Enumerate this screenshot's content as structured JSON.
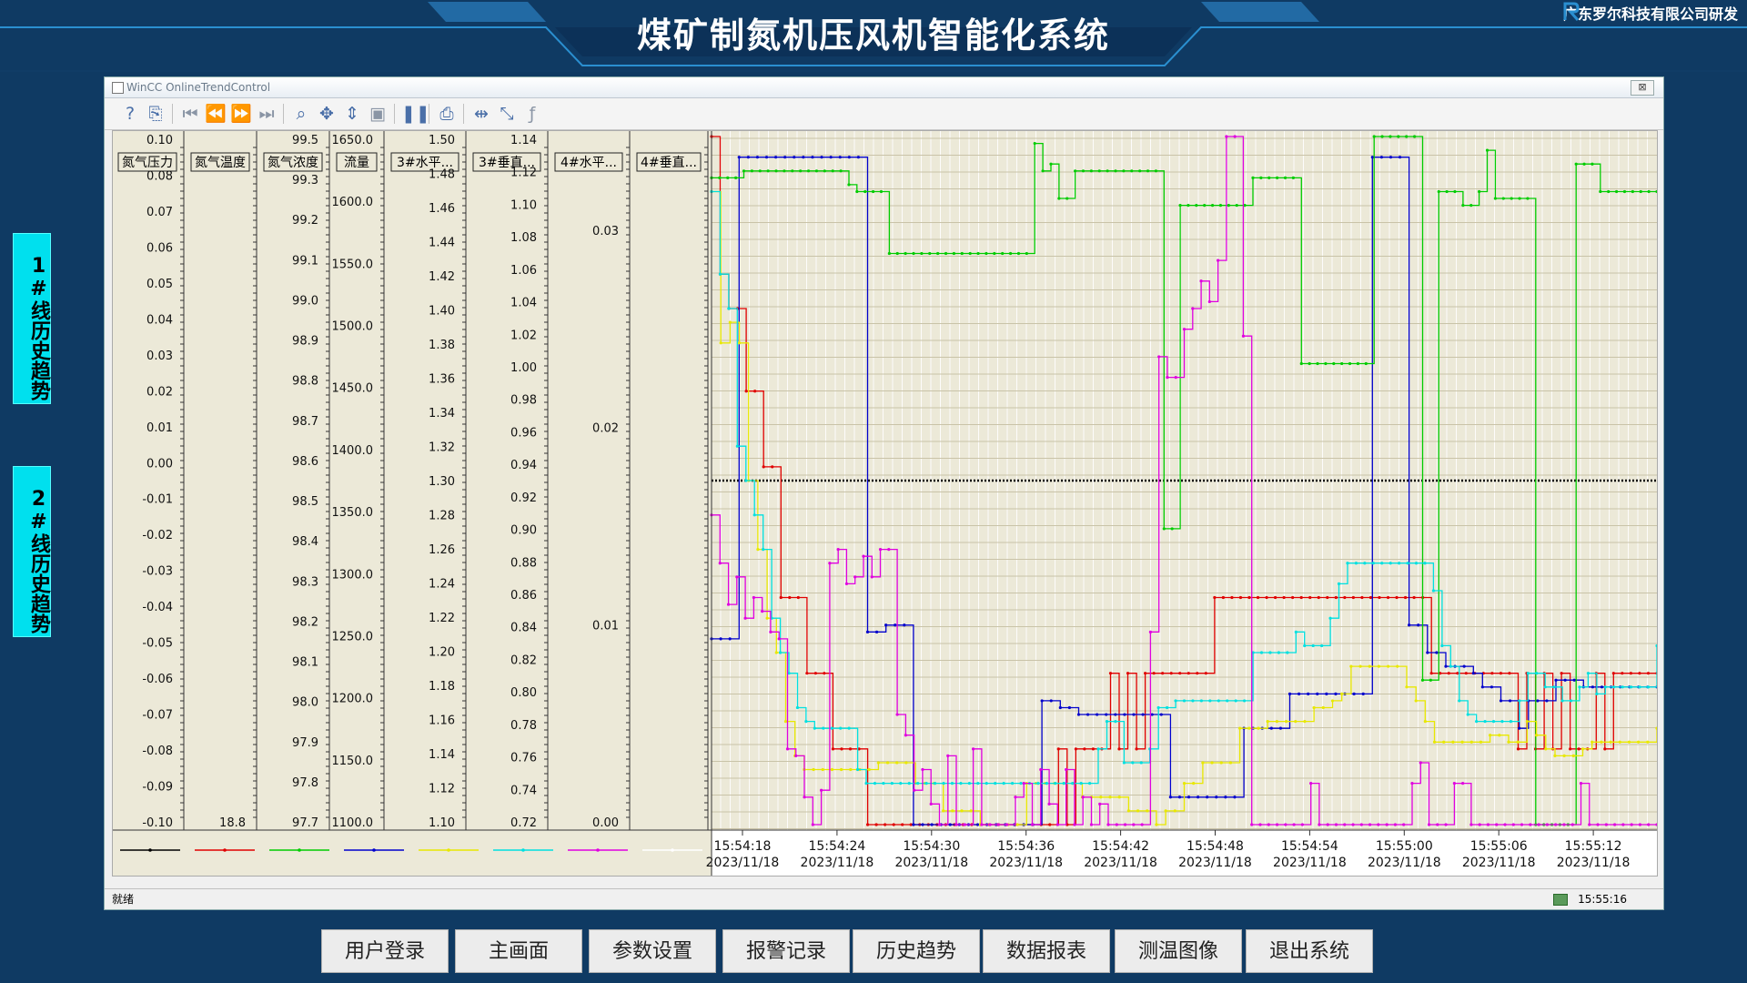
{
  "header": {
    "title": "煤矿制氮机压风机智能化系统",
    "company": "广东罗尔科技有限公司研发"
  },
  "side": {
    "line1": "1#线历史趋势",
    "line2": "2#线历史趋势"
  },
  "window": {
    "title": "WinCC OnlineTrendControl",
    "close": "⊠",
    "status_left": "就绪",
    "status_time": "15:55:16"
  },
  "colors": {
    "bg": "#0f3a63",
    "plot_bg": "#ece9d8",
    "cyan": "#00e0ee"
  },
  "axes": [
    {
      "label": "氮气压力",
      "ticks": [
        "0.10",
        "0.08",
        "0.07",
        "0.06",
        "0.05",
        "0.04",
        "0.03",
        "0.02",
        "0.01",
        "0.00",
        "-0.01",
        "-0.02",
        "-0.03",
        "-0.04",
        "-0.05",
        "-0.06",
        "-0.07",
        "-0.08",
        "-0.09",
        "-0.10"
      ]
    },
    {
      "label": "氮气温度",
      "ticks": [
        "18.8"
      ]
    },
    {
      "label": "氮气浓度",
      "ticks": [
        "99.5",
        "99.3",
        "99.2",
        "99.1",
        "99.0",
        "98.9",
        "98.8",
        "98.7",
        "98.6",
        "98.5",
        "98.4",
        "98.3",
        "98.2",
        "98.1",
        "98.0",
        "97.9",
        "97.8",
        "97.7"
      ]
    },
    {
      "label": "流量",
      "ticks": [
        "1650.0",
        "1600.0",
        "1550.0",
        "1500.0",
        "1450.0",
        "1400.0",
        "1350.0",
        "1300.0",
        "1250.0",
        "1200.0",
        "1150.0",
        "1100.0"
      ]
    },
    {
      "label": "3#水平...",
      "ticks": [
        "1.50",
        "1.48",
        "1.46",
        "1.44",
        "1.42",
        "1.40",
        "1.38",
        "1.36",
        "1.34",
        "1.32",
        "1.30",
        "1.28",
        "1.26",
        "1.24",
        "1.22",
        "1.20",
        "1.18",
        "1.16",
        "1.14",
        "1.12",
        "1.10"
      ]
    },
    {
      "label": "3#垂直...",
      "ticks": [
        "1.14",
        "1.12",
        "1.10",
        "1.08",
        "1.06",
        "1.04",
        "1.02",
        "1.00",
        "0.98",
        "0.96",
        "0.94",
        "0.92",
        "0.90",
        "0.88",
        "0.86",
        "0.84",
        "0.82",
        "0.80",
        "0.78",
        "0.76",
        "0.74",
        "0.72"
      ]
    },
    {
      "label": "4#水平...",
      "ticks": [
        "0.03",
        "0.02",
        "0.01",
        "0.00"
      ]
    },
    {
      "label": "4#垂直...",
      "ticks": []
    }
  ],
  "legend_colors": [
    "#000000",
    "#e00000",
    "#00cc00",
    "#0000cc",
    "#e8e800",
    "#00e0e0",
    "#e000e0",
    "#ffffff"
  ],
  "series": [
    {
      "color": "#e00000",
      "values": [
        1.0,
        0.8,
        0.75,
        0.75,
        0.63,
        0.63,
        0.52,
        0.52,
        0.33,
        0.33,
        0.33,
        0.22,
        0.22,
        0.22,
        0.11,
        0.11,
        0.11,
        0.11,
        0.0,
        0.0,
        0.0,
        0.0,
        0.0,
        0.0,
        0.0,
        0.0,
        0.0,
        0.0,
        0.0,
        0.0,
        0.0,
        0.0,
        0.0,
        0.0,
        0.0,
        0.0,
        0.0,
        0.0,
        0.0,
        0.0,
        0.11,
        0.0,
        0.11,
        0.11,
        0.11,
        0.11,
        0.22,
        0.11,
        0.22,
        0.11,
        0.22,
        0.22,
        0.22,
        0.22,
        0.22,
        0.22,
        0.22,
        0.22,
        0.33,
        0.33,
        0.33,
        0.33,
        0.33,
        0.33,
        0.33,
        0.33,
        0.33,
        0.33,
        0.33,
        0.33,
        0.33,
        0.33,
        0.33,
        0.33,
        0.33,
        0.33,
        0.33,
        0.33,
        0.33,
        0.33,
        0.33,
        0.33,
        0.33,
        0.22,
        0.22,
        0.22,
        0.22,
        0.22,
        0.22,
        0.22,
        0.22,
        0.22,
        0.22,
        0.11,
        0.22,
        0.11,
        0.22,
        0.11,
        0.22,
        0.11,
        0.11,
        0.11,
        0.22,
        0.11,
        0.22,
        0.22,
        0.22,
        0.22,
        0.22,
        0.22
      ]
    },
    {
      "color": "#0000cc",
      "values": [
        0.27,
        0.27,
        0.27,
        0.97,
        0.97,
        0.97,
        0.97,
        0.97,
        0.97,
        0.97,
        0.97,
        0.97,
        0.97,
        0.97,
        0.97,
        0.97,
        0.97,
        0.28,
        0.28,
        0.29,
        0.29,
        0.29,
        0.0,
        0.0,
        0.0,
        0.0,
        0.0,
        0.0,
        0.0,
        0.0,
        0.0,
        0.0,
        0.0,
        0.0,
        0.0,
        0.0,
        0.18,
        0.18,
        0.17,
        0.17,
        0.16,
        0.16,
        0.16,
        0.16,
        0.16,
        0.16,
        0.16,
        0.16,
        0.16,
        0.16,
        0.04,
        0.04,
        0.04,
        0.04,
        0.04,
        0.04,
        0.04,
        0.04,
        0.14,
        0.14,
        0.14,
        0.14,
        0.14,
        0.19,
        0.19,
        0.19,
        0.19,
        0.19,
        0.19,
        0.19,
        0.19,
        0.19,
        0.97,
        0.97,
        0.97,
        0.97,
        0.29,
        0.29,
        0.25,
        0.25,
        0.23,
        0.23,
        0.23,
        0.22,
        0.2,
        0.2,
        0.18,
        0.18,
        0.14,
        0.18,
        0.18,
        0.18,
        0.21,
        0.21,
        0.21,
        0.2,
        0.2,
        0.2,
        0.2,
        0.2,
        0.2,
        0.2,
        0.2,
        0.2
      ]
    },
    {
      "color": "#00cc00",
      "values": [
        0.94,
        0.94,
        0.94,
        0.94,
        0.95,
        0.95,
        0.95,
        0.95,
        0.95,
        0.95,
        0.95,
        0.95,
        0.95,
        0.95,
        0.95,
        0.95,
        0.95,
        0.93,
        0.92,
        0.92,
        0.92,
        0.92,
        0.83,
        0.83,
        0.83,
        0.83,
        0.83,
        0.83,
        0.83,
        0.83,
        0.83,
        0.83,
        0.83,
        0.83,
        0.83,
        0.83,
        0.83,
        0.83,
        0.83,
        0.83,
        0.99,
        0.95,
        0.96,
        0.91,
        0.91,
        0.95,
        0.95,
        0.95,
        0.95,
        0.95,
        0.95,
        0.95,
        0.95,
        0.95,
        0.95,
        0.95,
        0.43,
        0.43,
        0.9,
        0.9,
        0.9,
        0.9,
        0.9,
        0.9,
        0.9,
        0.9,
        0.9,
        0.94,
        0.94,
        0.94,
        0.94,
        0.94,
        0.94,
        0.67,
        0.67,
        0.67,
        0.67,
        0.67,
        0.67,
        0.67,
        0.67,
        0.67,
        1.0,
        1.0,
        1.0,
        1.0,
        1.0,
        1.0,
        0.21,
        0.21,
        0.92,
        0.92,
        0.92,
        0.9,
        0.9,
        0.92,
        0.98,
        0.91,
        0.91,
        0.91,
        0.91,
        0.91,
        0.0,
        0.0,
        0.0,
        0.0,
        0.0,
        0.96,
        0.96,
        0.96,
        0.92,
        0.92,
        0.92,
        0.92,
        0.92,
        0.92,
        0.92,
        0.92
      ]
    },
    {
      "color": "#e8e800",
      "values": [
        0.92,
        0.7,
        0.73,
        0.7,
        0.5,
        0.4,
        0.3,
        0.25,
        0.15,
        0.1,
        0.08,
        0.08,
        0.08,
        0.08,
        0.08,
        0.08,
        0.08,
        0.08,
        0.09,
        0.09,
        0.09,
        0.09,
        0.06,
        0.06,
        0.06,
        0.02,
        0.02,
        0.02,
        0.02,
        0.0,
        0.0,
        0.0,
        0.0,
        0.0,
        0.06,
        0.06,
        0.06,
        0.06,
        0.06,
        0.06,
        0.04,
        0.04,
        0.04,
        0.04,
        0.04,
        0.02,
        0.02,
        0.02,
        0.0,
        0.02,
        0.02,
        0.06,
        0.06,
        0.09,
        0.09,
        0.09,
        0.09,
        0.14,
        0.14,
        0.14,
        0.15,
        0.15,
        0.15,
        0.15,
        0.15,
        0.17,
        0.17,
        0.18,
        0.19,
        0.23,
        0.23,
        0.23,
        0.23,
        0.23,
        0.23,
        0.2,
        0.18,
        0.15,
        0.12,
        0.12,
        0.12,
        0.12,
        0.12,
        0.12,
        0.13,
        0.13,
        0.12,
        0.12,
        0.15,
        0.13,
        0.11,
        0.1,
        0.1,
        0.1,
        0.11,
        0.12,
        0.12,
        0.12,
        0.12,
        0.12,
        0.12,
        0.12,
        0.14
      ]
    },
    {
      "color": "#00e0e0",
      "values": [
        0.92,
        0.8,
        0.75,
        0.55,
        0.5,
        0.45,
        0.4,
        0.3,
        0.25,
        0.22,
        0.17,
        0.15,
        0.14,
        0.14,
        0.14,
        0.14,
        0.14,
        0.08,
        0.06,
        0.06,
        0.06,
        0.06,
        0.06,
        0.06,
        0.06,
        0.06,
        0.06,
        0.06,
        0.06,
        0.06,
        0.06,
        0.06,
        0.06,
        0.06,
        0.06,
        0.06,
        0.06,
        0.06,
        0.06,
        0.06,
        0.06,
        0.06,
        0.06,
        0.06,
        0.06,
        0.11,
        0.15,
        0.15,
        0.09,
        0.09,
        0.09,
        0.11,
        0.17,
        0.17,
        0.18,
        0.18,
        0.18,
        0.18,
        0.18,
        0.18,
        0.18,
        0.18,
        0.18,
        0.25,
        0.25,
        0.25,
        0.25,
        0.25,
        0.28,
        0.26,
        0.26,
        0.26,
        0.3,
        0.35,
        0.38,
        0.38,
        0.38,
        0.38,
        0.38,
        0.38,
        0.38,
        0.38,
        0.38,
        0.38,
        0.34,
        0.26,
        0.23,
        0.18,
        0.16,
        0.15,
        0.15,
        0.15,
        0.15,
        0.15,
        0.18,
        0.22,
        0.22,
        0.2,
        0.2,
        0.18,
        0.18,
        0.2,
        0.22,
        0.19,
        0.2,
        0.2,
        0.2,
        0.2,
        0.2,
        0.2,
        0.26
      ]
    },
    {
      "color": "#e000e0",
      "values": [
        0.45,
        0.38,
        0.32,
        0.36,
        0.3,
        0.33,
        0.31,
        0.28,
        0.27,
        0.11,
        0.1,
        0.04,
        0.0,
        0.05,
        0.38,
        0.4,
        0.35,
        0.36,
        0.39,
        0.36,
        0.4,
        0.4,
        0.16,
        0.13,
        0.05,
        0.08,
        0.03,
        0.0,
        0.1,
        0.0,
        0.0,
        0.11,
        0.0,
        0.0,
        0.0,
        0.0,
        0.04,
        0.06,
        0.0,
        0.08,
        0.03,
        0.0,
        0.08,
        0.0,
        0.04,
        0.0,
        0.03,
        0.0,
        0.0,
        0.0,
        0.0,
        0.0,
        0.28,
        0.68,
        0.65,
        0.65,
        0.72,
        0.75,
        0.79,
        0.76,
        0.82,
        1.0,
        1.0,
        0.71,
        0.0,
        0.0,
        0.0,
        0.0,
        0.0,
        0.0,
        0.0,
        0.06,
        0.0,
        0.0,
        0.0,
        0.0,
        0.0,
        0.0,
        0.0,
        0.0,
        0.0,
        0.0,
        0.0,
        0.06,
        0.09,
        0.0,
        0.0,
        0.0,
        0.06,
        0.06,
        0.0,
        0.0,
        0.0,
        0.0,
        0.0,
        0.0,
        0.0,
        0.0,
        0.0,
        0.0,
        0.0,
        0.0,
        0.0,
        0.06,
        0.0,
        0.0,
        0.0,
        0.0,
        0.0,
        0.0,
        0.0,
        0.0,
        0.0
      ]
    }
  ],
  "x_ticks": [
    {
      "time": "15:54:18",
      "date": "2023/11/18"
    },
    {
      "time": "15:54:24",
      "date": "2023/11/18"
    },
    {
      "time": "15:54:30",
      "date": "2023/11/18"
    },
    {
      "time": "15:54:36",
      "date": "2023/11/18"
    },
    {
      "time": "15:54:42",
      "date": "2023/11/18"
    },
    {
      "time": "15:54:48",
      "date": "2023/11/18"
    },
    {
      "time": "15:54:54",
      "date": "2023/11/18"
    },
    {
      "time": "15:55:00",
      "date": "2023/11/18"
    },
    {
      "time": "15:55:06",
      "date": "2023/11/18"
    },
    {
      "time": "15:55:12",
      "date": "2023/11/18"
    }
  ],
  "nav": [
    "用户登录",
    "主画面",
    "参数设置",
    "报警记录",
    "历史趋势",
    "数据报表",
    "测温图像",
    "退出系统"
  ]
}
